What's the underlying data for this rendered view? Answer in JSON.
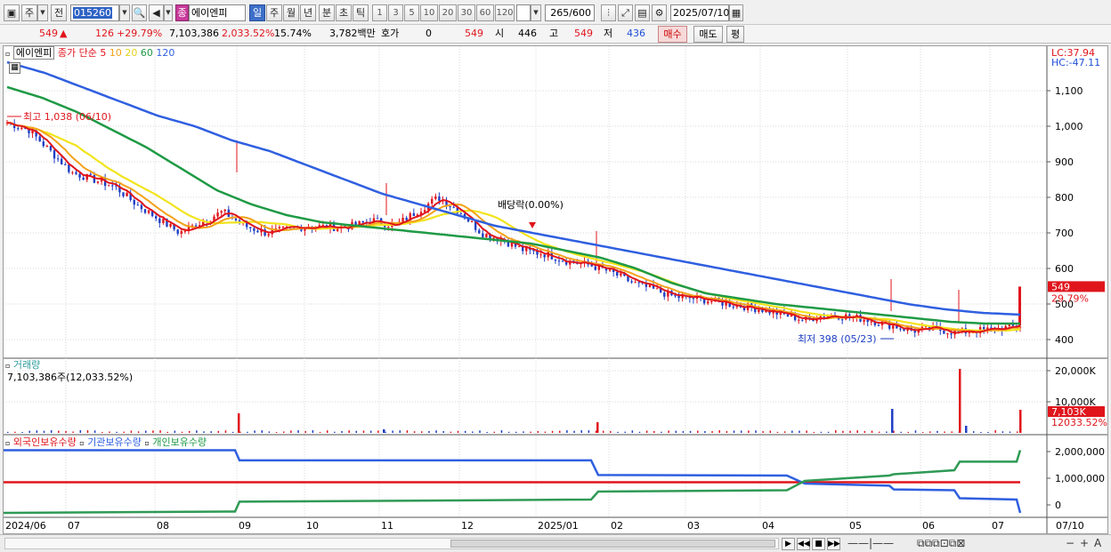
{
  "toolbar": {
    "period_type": "주",
    "prev_label": "전",
    "stock_code": "015260",
    "stock_name_tag": "종",
    "stock_name": "에이엔피",
    "period_tabs": [
      "일",
      "주",
      "월",
      "년",
      "분",
      "초",
      "틱"
    ],
    "minute_options": [
      "1",
      "3",
      "5",
      "10",
      "20",
      "30",
      "60",
      "120"
    ],
    "count": "265",
    "count_total": "/600",
    "date": "2025/07/10"
  },
  "quote": {
    "price": "549",
    "change": "126",
    "change_pct": "+29.79%",
    "volume": "7,103,386",
    "volume_ratio": "2,033.52%",
    "turnover": "15.74%",
    "amount": "3,782백만",
    "hoga_label": "호가",
    "hoga_value": "0",
    "hoga_price": "549",
    "open_label": "시",
    "open": "446",
    "high_label": "고",
    "high": "549",
    "low_label": "저",
    "low": "436",
    "buy_label": "매수",
    "sell_label": "매도",
    "eval_label": "평"
  },
  "price_panel": {
    "stock_name": "에이엔피",
    "ma_title": "종가 단순",
    "ma_periods": [
      "5",
      "10",
      "20",
      "60",
      "120"
    ],
    "lc_label": "LC:37.94",
    "hc_label": "HC:-47.11",
    "y_ticks": [
      "1,100",
      "1,000",
      "900",
      "800",
      "700",
      "600",
      "500",
      "400"
    ],
    "last_price": "549",
    "last_pct": "29.79%",
    "high_annotation": "최고 1,038 (06/10)",
    "low_annotation": "최저 398 (05/23)",
    "dividend_annotation": "배당락(0.00%)"
  },
  "volume_panel": {
    "title": "거래량",
    "value_label": "7,103,386주(12,033.52%)",
    "y_ticks": [
      "20,000K",
      "10,000K"
    ],
    "last_value": "7,103K",
    "last_pct": "12033.52%"
  },
  "holdings_panel": {
    "series_labels": [
      "외국인보유수량",
      "기관보유수량",
      "개인보유수량"
    ],
    "y_ticks": [
      "2,000,000",
      "1,000,000",
      "0"
    ]
  },
  "x_axis": {
    "labels": [
      "2024/06",
      "07",
      "08",
      "09",
      "10",
      "11",
      "12",
      "2025/01",
      "02",
      "03",
      "04",
      "05",
      "06",
      "07"
    ],
    "right_label": "07/10"
  },
  "colors": {
    "ma5": "#e0151c",
    "ma10": "#f3a21a",
    "ma20": "#f2e41c",
    "ma60": "#1f9a45",
    "ma120": "#2f5fe0",
    "up": "#e0151c",
    "down": "#1f3fc4"
  },
  "chart_data": {
    "type": "line",
    "note_series": "approximate weekly/daily price and moving averages read from chart",
    "x": [
      "2024/06",
      "07",
      "08",
      "09",
      "10",
      "11",
      "12",
      "2025/01",
      "02",
      "03",
      "04",
      "05",
      "06",
      "07"
    ],
    "series": [
      {
        "name": "종가",
        "values": [
          1010,
          880,
          760,
          730,
          720,
          740,
          620,
          600,
          530,
          500,
          470,
          440,
          420,
          549
        ]
      },
      {
        "name": "60",
        "values": [
          1110,
          960,
          820,
          760,
          720,
          700,
          670,
          640,
          580,
          530,
          500,
          470,
          450,
          445
        ]
      },
      {
        "name": "120",
        "values": [
          1180,
          1100,
          1010,
          960,
          900,
          840,
          770,
          720,
          670,
          620,
          580,
          540,
          500,
          475
        ]
      }
    ],
    "ylim": [
      380,
      1180
    ]
  }
}
